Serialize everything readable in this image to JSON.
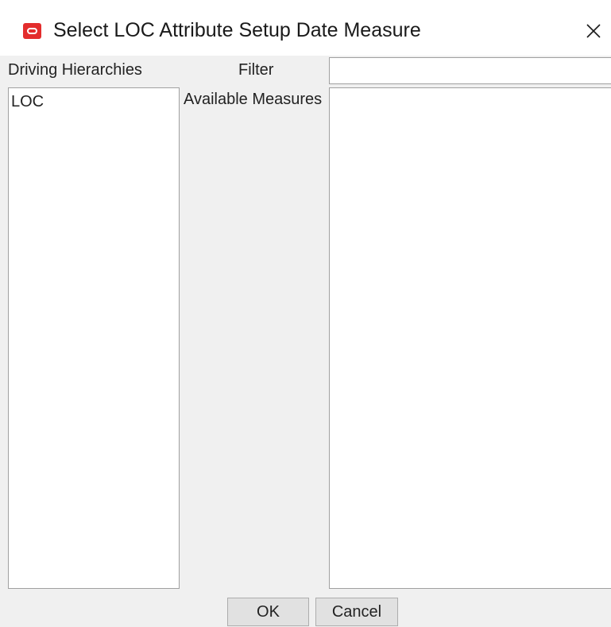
{
  "window": {
    "title": "Select LOC Attribute Setup Date Measure",
    "icon": "oracle-icon",
    "close_icon": "close-icon"
  },
  "driving_hierarchies": {
    "label": "Driving Hierarchies",
    "items": [
      "LOC"
    ]
  },
  "filter": {
    "label": "Filter",
    "value": "",
    "placeholder": ""
  },
  "available_measures": {
    "label": "Available Measures",
    "items": []
  },
  "buttons": {
    "ok_label": "OK",
    "cancel_label": "Cancel"
  },
  "colors": {
    "accent": "#e32d2d",
    "client_background": "#f0f0f0"
  }
}
